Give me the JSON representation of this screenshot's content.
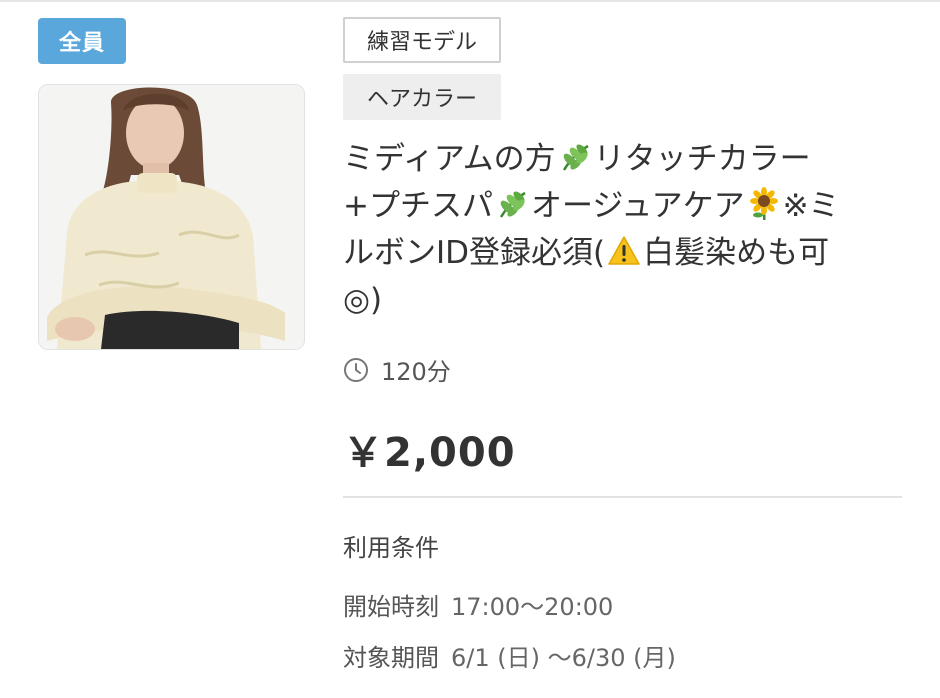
{
  "badge": {
    "label": "全員",
    "color": "#5aa7dc"
  },
  "tags": [
    {
      "label": "練習モデル",
      "style": "outline"
    },
    {
      "label": "ヘアカラー",
      "style": "filled"
    }
  ],
  "title": {
    "line1_a": "ミディアムの方",
    "line1_b": "リタッチカラー",
    "line2_a": "+プチスパ",
    "line2_b": "オージュアケア",
    "line2_c": "※ミ",
    "line3_a": "ルボンID登録必須(",
    "line3_b": "白髪染めも可",
    "line4": "◎)",
    "emojis": [
      "herb-emoji",
      "herb-emoji",
      "sunflower-emoji",
      "warning-emoji"
    ]
  },
  "duration": {
    "icon": "clock-icon",
    "text": "120分"
  },
  "price": "￥2,000",
  "conditions": {
    "heading": "利用条件",
    "start_time_label": "開始時刻",
    "start_time_value": "17:00〜20:00",
    "period_label": "対象期間",
    "period_value": "6/1 (日) 〜6/30 (月)"
  }
}
